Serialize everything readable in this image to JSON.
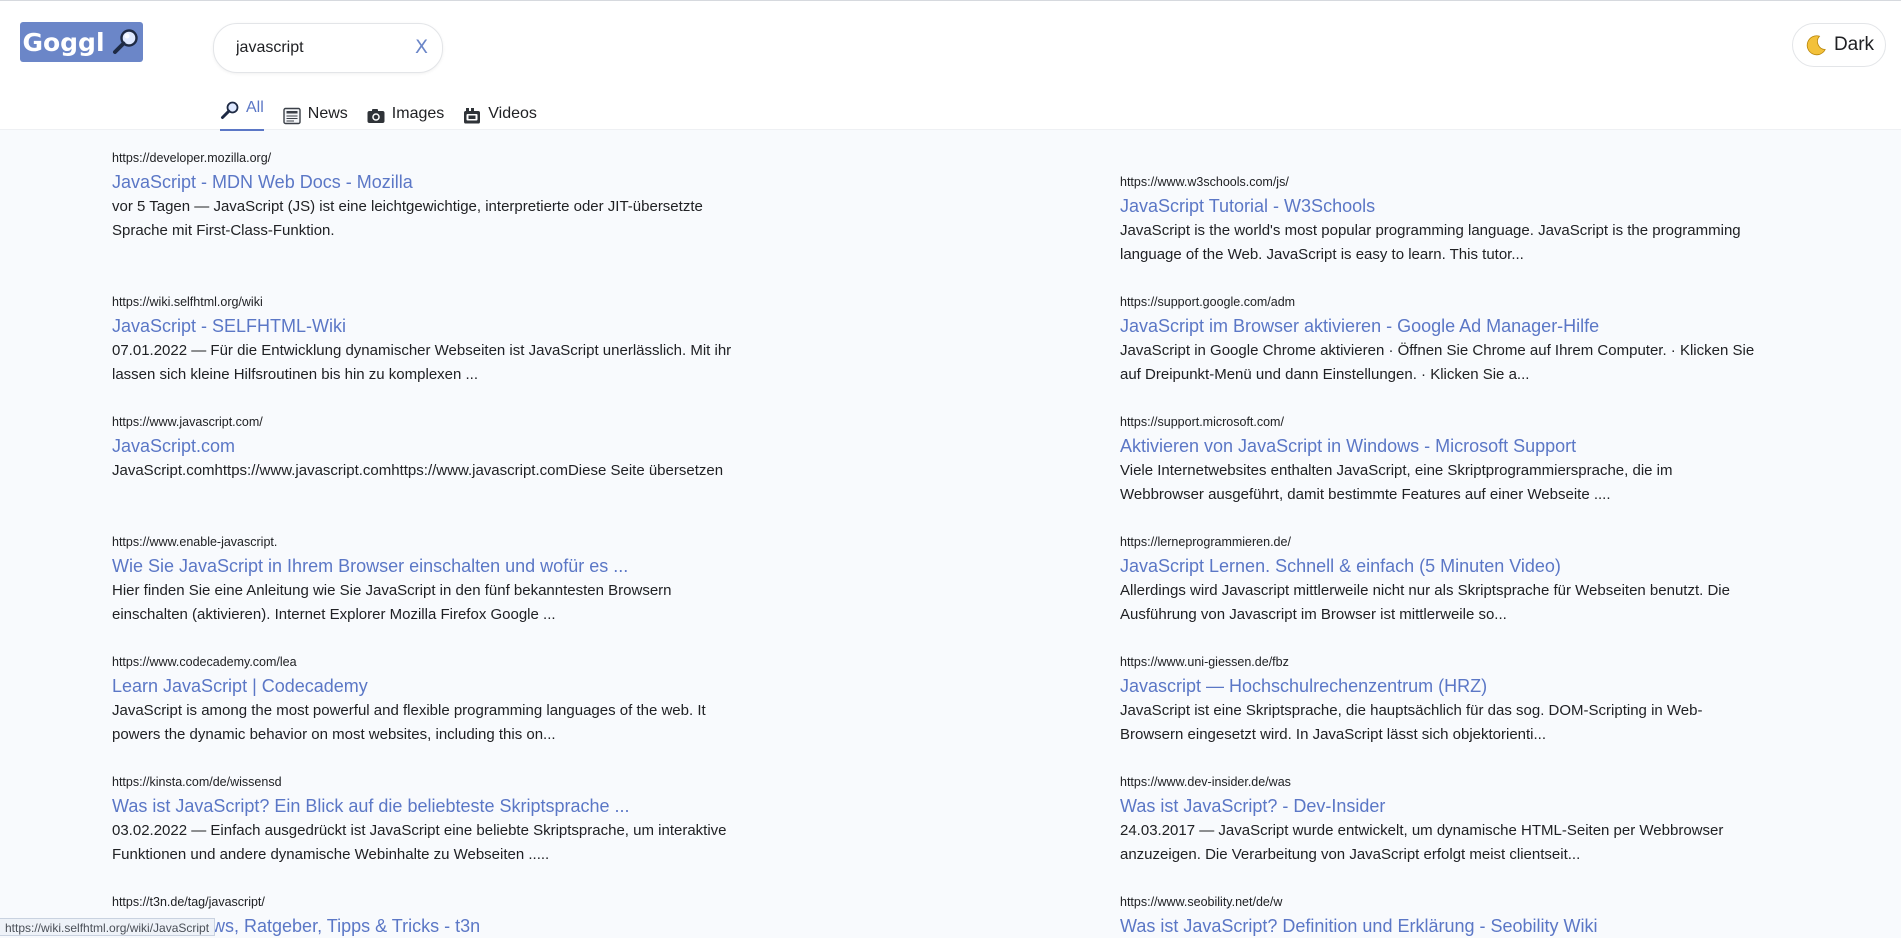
{
  "header": {
    "logo_text": "Goggl",
    "search": {
      "value": "javascript",
      "clear_label": "X"
    },
    "tabs": [
      {
        "label": "All",
        "icon": "magnifier-icon",
        "active": true
      },
      {
        "label": "News",
        "icon": "newspaper-icon",
        "active": false
      },
      {
        "label": "Images",
        "icon": "camera-icon",
        "active": false
      },
      {
        "label": "Videos",
        "icon": "video-camera-icon",
        "active": false
      }
    ],
    "theme_toggle": {
      "label": "Dark",
      "icon": "moon-icon"
    }
  },
  "accent_color": "#5b77c6",
  "results": [
    {
      "url": "https://developer.mozilla.org/",
      "title": "JavaScript - MDN Web Docs - Mozilla",
      "lines": [
        "vor 5 Tagen — JavaScript (JS) ist eine leichtgewichtige, interpretierte oder JIT-übersetzte",
        "Sprache mit First-Class-Funktion."
      ]
    },
    {
      "url": "https://www.w3schools.com/js/",
      "title": "JavaScript Tutorial - W3Schools",
      "lines": [
        "JavaScript is the world's most popular programming language. JavaScript is the programming",
        "language of the Web. JavaScript is easy to learn. This tutor..."
      ]
    },
    {
      "url": "https://wiki.selfhtml.org/wiki",
      "title": "JavaScript - SELFHTML-Wiki",
      "lines": [
        "07.01.2022 — Für die Entwicklung dynamischer Webseiten ist JavaScript unerlässlich. Mit ihr",
        "lassen sich kleine Hilfsroutinen bis hin zu komplexen ..."
      ]
    },
    {
      "url": "https://support.google.com/adm",
      "title": "JavaScript im Browser aktivieren - Google Ad Manager-Hilfe",
      "lines": [
        "JavaScript in Google Chrome aktivieren · Öffnen Sie Chrome auf Ihrem Computer. · Klicken Sie",
        "auf Dreipunkt-Menü und dann Einstellungen. · Klicken Sie a..."
      ]
    },
    {
      "url": "https://www.javascript.com/",
      "title": "JavaScript.com",
      "lines": [
        "JavaScript.comhttps://www.javascript.comhttps://www.javascript.comDiese Seite übersetzen"
      ]
    },
    {
      "url": "https://support.microsoft.com/",
      "title": "Aktivieren von JavaScript in Windows - Microsoft Support",
      "lines": [
        "Viele Internetwebsites enthalten JavaScript, eine Skriptprogrammiersprache, die im",
        "Webbrowser ausgeführt, damit bestimmte Features auf einer Webseite ...."
      ]
    },
    {
      "url": "https://www.enable-javascript.",
      "title": "Wie Sie JavaScript in Ihrem Browser einschalten und wofür es ...",
      "lines": [
        "Hier finden Sie eine Anleitung wie Sie JavaScript in den fünf bekanntesten Browsern",
        "einschalten (aktivieren). Internet Explorer Mozilla Firefox Google ..."
      ]
    },
    {
      "url": "https://lerneprogrammieren.de/",
      "title": "JavaScript Lernen. Schnell & einfach (5 Minuten Video)",
      "lines": [
        "Allerdings wird Javascript mittlerweile nicht nur als Skriptsprache für Webseiten benutzt. Die",
        "Ausführung von Javascript im Browser ist mittlerweile so..."
      ]
    },
    {
      "url": "https://www.codecademy.com/lea",
      "title": "Learn JavaScript | Codecademy",
      "lines": [
        "JavaScript is among the most powerful and flexible programming languages of the web. It",
        "powers the dynamic behavior on most websites, including this on..."
      ]
    },
    {
      "url": "https://www.uni-giessen.de/fbz",
      "title": "Javascript — Hochschulrechenzentrum (HRZ)",
      "lines": [
        "JavaScript ist eine Skriptsprache, die hauptsächlich für das sog. DOM-Scripting in Web-",
        "Browsern eingesetzt wird. In JavaScript lässt sich objektorienti..."
      ]
    },
    {
      "url": "https://kinsta.com/de/wissensd",
      "title": "Was ist JavaScript? Ein Blick auf die beliebteste Skriptsprache ...",
      "lines": [
        "03.02.2022 — Einfach ausgedrückt ist JavaScript eine beliebte Skriptsprache, um interaktive",
        "Funktionen und andere dynamische Webinhalte zu Webseiten ....."
      ]
    },
    {
      "url": "https://www.dev-insider.de/was",
      "title": "Was ist JavaScript? - Dev-Insider",
      "lines": [
        "24.03.2017 — JavaScript wurde entwickelt, um dynamische HTML-Seiten per Webbrowser",
        "anzuzeigen. Die Verarbeitung von JavaScript erfolgt meist clientseit..."
      ]
    },
    {
      "url": "https://t3n.de/tag/javascript/",
      "title": "ews, Ratgeber, Tipps & Tricks - t3n",
      "lines": []
    },
    {
      "url": "https://www.seobility.net/de/w",
      "title": "Was ist JavaScript? Definition und Erklärung - Seobility Wiki",
      "lines": []
    }
  ],
  "status_bar": "https://wiki.selfhtml.org/wiki/JavaScript"
}
